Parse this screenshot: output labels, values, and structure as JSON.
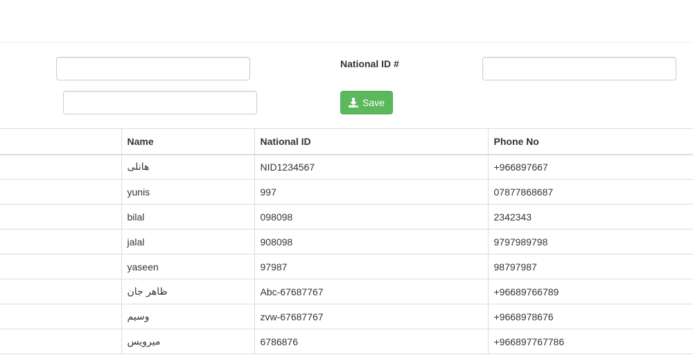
{
  "form": {
    "input_a_value": "",
    "input_b_value": "",
    "national_id_label": "National ID #",
    "national_id_value": "",
    "save_label": "Save",
    "save_icon": "download-icon"
  },
  "colors": {
    "save_button_bg": "#5cb85c",
    "border": "#dddddd"
  },
  "table": {
    "columns": [
      "",
      "Name",
      "National ID",
      "Phone No"
    ],
    "rows": [
      {
        "select": "",
        "name": "هانلى",
        "national_id": "NID1234567",
        "phone": "+966897667"
      },
      {
        "select": "",
        "name": "yunis",
        "national_id": "997",
        "phone": "07877868687"
      },
      {
        "select": "",
        "name": "bilal",
        "national_id": "098098",
        "phone": "2342343"
      },
      {
        "select": "",
        "name": "jalal",
        "national_id": "908098",
        "phone": "9797989798"
      },
      {
        "select": "",
        "name": "yaseen",
        "national_id": "97987",
        "phone": "98797987"
      },
      {
        "select": "",
        "name": "ظاهر جان",
        "national_id": "Abc-67687767",
        "phone": "+96689766789"
      },
      {
        "select": "",
        "name": "وسيم",
        "national_id": "zvw-67687767",
        "phone": "+9668978676"
      },
      {
        "select": "",
        "name": "ميرويس",
        "national_id": "6786876",
        "phone": "+966897767786"
      }
    ]
  }
}
